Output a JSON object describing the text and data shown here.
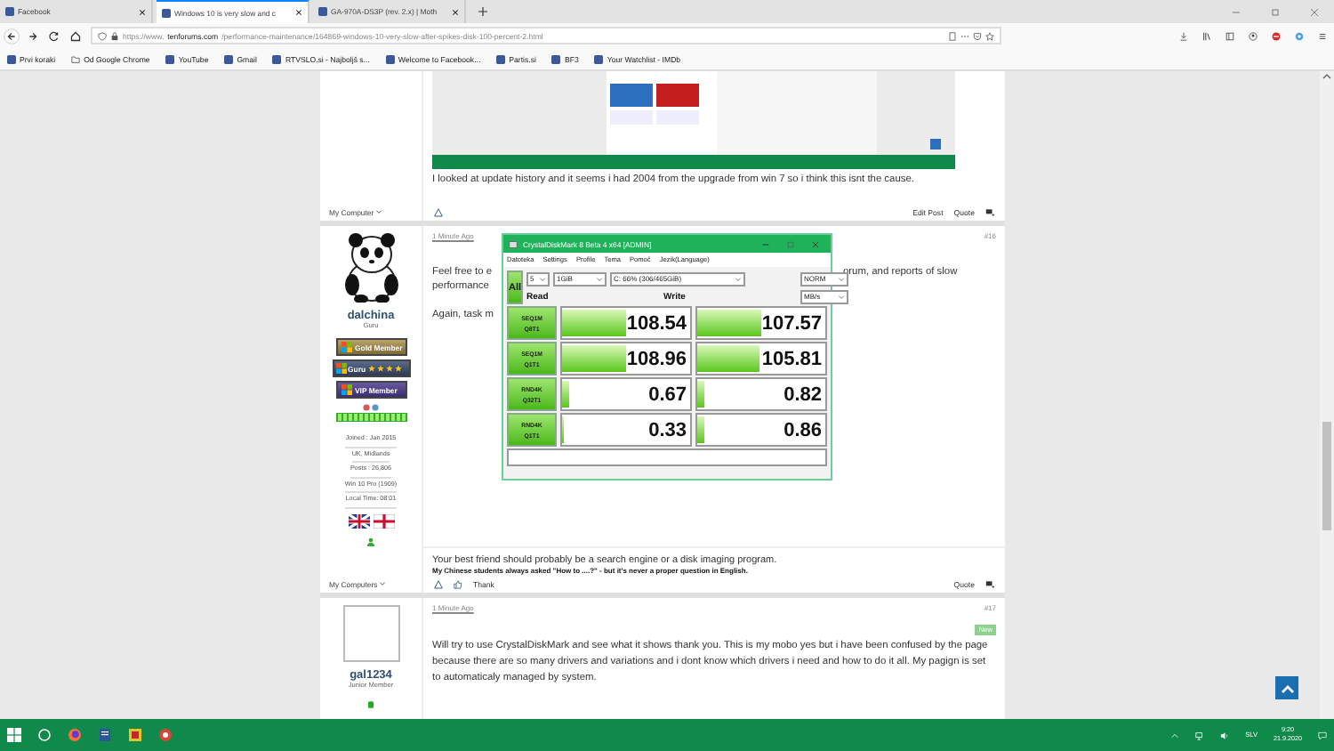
{
  "browser": {
    "tabs": [
      {
        "title": "Facebook",
        "selected": false
      },
      {
        "title": "Windows 10 is very slow and c",
        "selected": true
      },
      {
        "title": "GA-970A-DS3P (rev. 2.x) | Moth",
        "selected": false
      }
    ],
    "address": {
      "prefix": "https://www.",
      "domain": "tenforums.com",
      "path": "/performance-maintenance/164869-windows-10-very-slow-after-spikes-disk-100-percent-2.html"
    },
    "bookmarks": [
      {
        "label": "Prvi koraki",
        "kind": "site"
      },
      {
        "label": "Od Google Chrome",
        "kind": "folder"
      },
      {
        "label": "YouTube",
        "kind": "site"
      },
      {
        "label": "Gmail",
        "kind": "site"
      },
      {
        "label": "RTVSLO.si - Najboljš s...",
        "kind": "site"
      },
      {
        "label": "Welcome to Facebook...",
        "kind": "site"
      },
      {
        "label": "Partis.si",
        "kind": "site"
      },
      {
        "label": "BF3",
        "kind": "site"
      },
      {
        "label": "Your Watchlist - IMDb",
        "kind": "site"
      }
    ]
  },
  "posts": [
    {
      "kind": "continuation",
      "body": "I looked at update history and it seems i had 2004 from the upgrade from win 7 so i think this isnt the cause.",
      "sidebar_footer": "My Computer",
      "right_actions": [
        "Edit Post",
        "Quote"
      ]
    },
    {
      "kind": "reply",
      "time": "1 Minute Ago",
      "number": "#16",
      "user": {
        "avatar": {
          "kind": "panda"
        },
        "name": "dalchina",
        "title": "Guru",
        "badges": [
          {
            "label": "Gold Member",
            "kind": "gold"
          },
          {
            "label": "Guru",
            "kind": "guru",
            "stars": 4
          },
          {
            "label": "VIP Member",
            "kind": "vip"
          }
        ],
        "info": [
          "Joined : Jan 2015",
          "UK, Midlands",
          "Posts : 26,806",
          "Win 10 Pro (1909)",
          "Local Time: 08:01"
        ]
      },
      "paragraphs": [
        [
          {
            "left": "Feel free to e",
            "right": "orum, and reports of slow"
          },
          {
            "left": "performance"
          }
        ],
        [
          {
            "left": "Again, task m"
          }
        ]
      ],
      "signature": "Your best friend should probably be a search engine or a disk imaging program.",
      "signature_note": "My Chinese students always asked \"How to ....?\" - but it's never a proper question in English.",
      "sidebar_footer": "My Computers",
      "left_actions": [
        "Thank"
      ],
      "right_actions": [
        "Quote"
      ]
    },
    {
      "kind": "reply",
      "time": "1 Minute Ago",
      "number": "#17",
      "new_badge": "New",
      "user": {
        "avatar": {
          "kind": "blank"
        },
        "name": "gal1234",
        "title": "Junior Member"
      },
      "body": "Will try to use CrystalDiskMark and see what it shows thank you. This is my mobo yes but i have been confused by the page because there are so many drivers and variations and i dont know which drivers i need and how to do it all. My pagign is set to automaticaly managed by system."
    }
  ],
  "benchmark_window": {
    "title": "CrystalDiskMark 8 Beta 4 x64 [ADMIN]",
    "menu": [
      "Datoteka",
      "Settings",
      "Profile",
      "Tema",
      "Pomoč",
      "Jezik(Language)"
    ],
    "all_button": "All",
    "count": "5",
    "size": "1GiB",
    "drive": "C: 66% (306/465GiB)",
    "mode": "NORM",
    "unit": "MB/s",
    "read_header": "Read",
    "write_header": "Write",
    "rows": [
      {
        "test": "SEQ1M",
        "queue": "Q8T1",
        "read": {
          "value": "108.54",
          "level": 0.5
        },
        "write": {
          "value": "107.57",
          "level": 0.5
        }
      },
      {
        "test": "SEQ1M",
        "queue": "Q1T1",
        "read": {
          "value": "108.96",
          "level": 0.5
        },
        "write": {
          "value": "105.81",
          "level": 0.49
        }
      },
      {
        "test": "RND4K",
        "queue": "Q32T1",
        "read": {
          "value": "0.67",
          "level": 0.05
        },
        "write": {
          "value": "0.82",
          "level": 0.05
        }
      },
      {
        "test": "RND4K",
        "queue": "Q1T1",
        "read": {
          "value": "0.33",
          "level": 0.02
        },
        "write": {
          "value": "0.86",
          "level": 0.05
        }
      }
    ]
  },
  "taskbar": {
    "language": "SLV",
    "time": "9:20",
    "date": "21.9.2020"
  }
}
